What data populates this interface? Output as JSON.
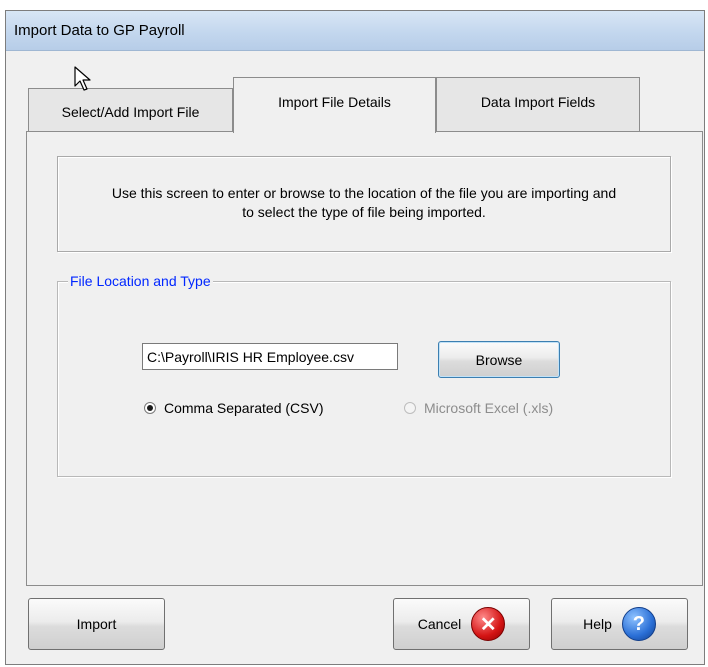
{
  "window": {
    "title": "Import Data to GP Payroll"
  },
  "tabs": [
    {
      "label": "Select/Add Import File"
    },
    {
      "label": "Import File Details"
    },
    {
      "label": "Data Import Fields"
    }
  ],
  "info": {
    "line1": "Use this screen to enter or browse to the location of the file you are importing and",
    "line2": "to select the type of file being imported."
  },
  "file_group": {
    "legend": "File Location and Type",
    "path_value": "C:\\Payroll\\IRIS HR Employee.csv",
    "browse_label": "Browse",
    "options": [
      {
        "label": "Comma Separated (CSV)",
        "checked": true,
        "enabled": true
      },
      {
        "label": "Microsoft Excel (.xls)",
        "checked": false,
        "enabled": false
      }
    ]
  },
  "buttons": {
    "import": "Import",
    "cancel": "Cancel",
    "help": "Help"
  },
  "icons": {
    "cancel": "close-circle-icon",
    "help": "help-circle-icon",
    "cursor": "mouse-pointer-icon"
  }
}
